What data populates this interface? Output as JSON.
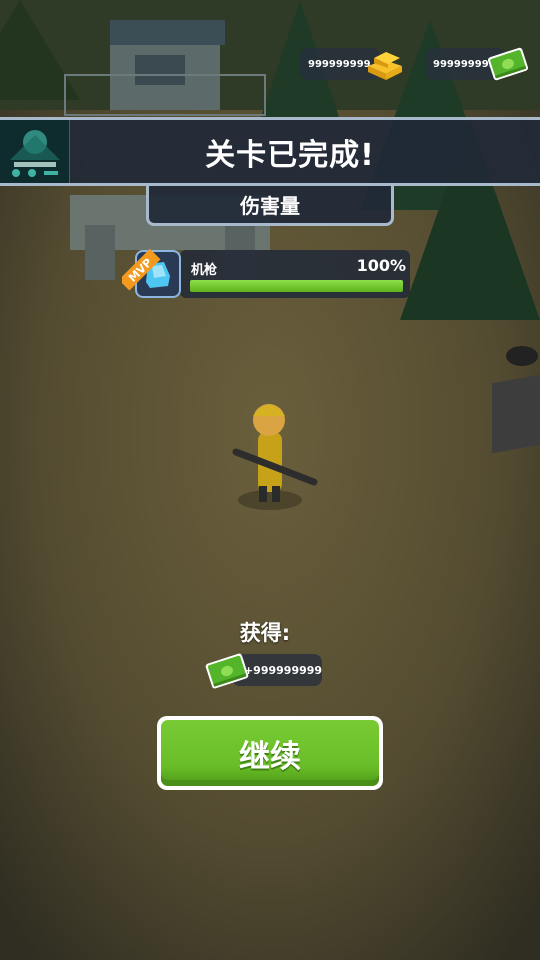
{
  "currencies": {
    "gold_amount": "999999999",
    "cash_amount": "999999999",
    "gold_icon": "gold-bar-icon",
    "cash_icon": "cash-stack-icon"
  },
  "banner": {
    "title": "关卡已完成!",
    "thumbnail_icon": "level-thumbnail-icon"
  },
  "damage": {
    "tab_label": "伤害量",
    "badge": "MVP",
    "weapon_name": "机枪",
    "percent_text": "100%",
    "percent": 100
  },
  "reward": {
    "label": "获得:",
    "amount": "+999999999",
    "icon": "cash-stack-icon"
  },
  "continue_button": {
    "label": "继续"
  },
  "colors": {
    "accent_green": "#69bd28",
    "panel_dark": "#212937",
    "panel_border": "#a9b9cc"
  }
}
